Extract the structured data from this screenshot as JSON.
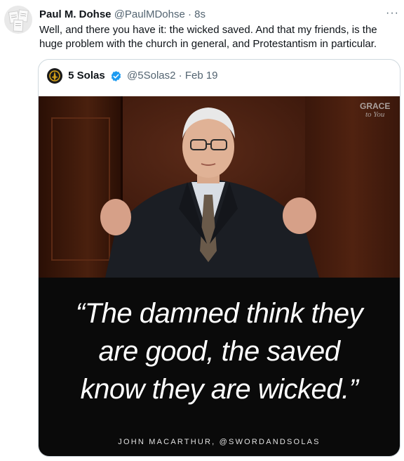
{
  "tweet": {
    "display_name": "Paul M. Dohse",
    "handle": "@PaulMDohse",
    "separator": "·",
    "time": "8s",
    "more_icon": "more-horizontal-icon",
    "text": "Well, and there you have it: the wicked saved. And that my friends, is the huge problem with the church in general, and Protestantism in particular."
  },
  "quoted": {
    "display_name": "5 Solas",
    "verified_color": "#1d9bf0",
    "handle": "@5Solas2",
    "separator": "·",
    "date": "Feb 19",
    "media": {
      "watermark_line1": "GRACE",
      "watermark_line2": "to You",
      "quote_line1": "“The damned think they",
      "quote_line2": "are good, the saved",
      "quote_line3": "know they are wicked.”",
      "attribution": "JOHN MACARTHUR, @SWORDANDSOLAS"
    }
  }
}
